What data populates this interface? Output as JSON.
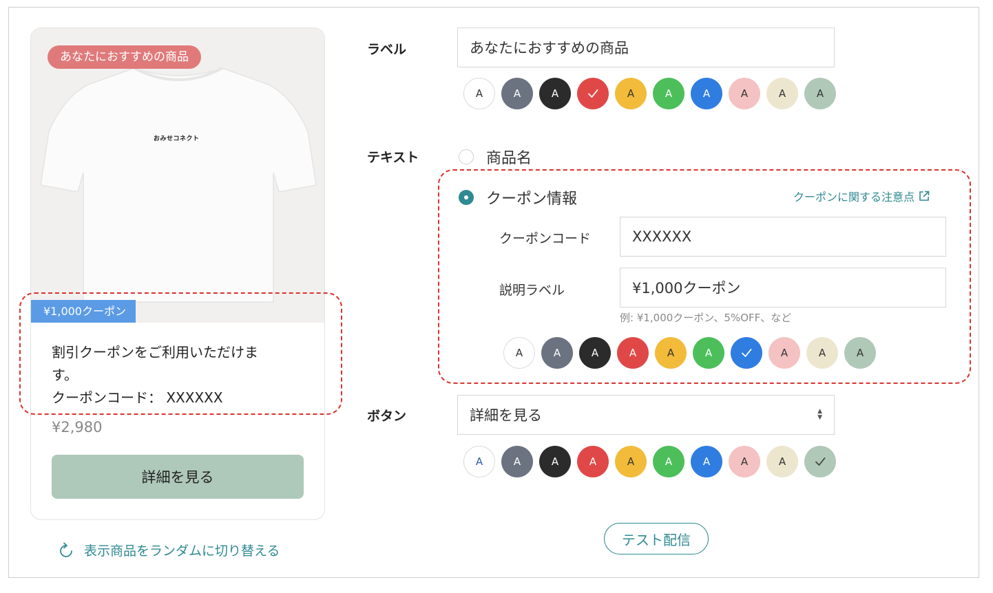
{
  "preview": {
    "recommend_badge": "あなたにおすすめの商品",
    "shirt_logo_text": "おみせコネクト",
    "coupon_tag": "¥1,000クーポン",
    "desc_line1": "割引クーポンをご利用いただけま",
    "desc_line2": "す。",
    "code_line": "クーポンコード： XXXXXX",
    "price": "¥2,980",
    "detail_button": "詳細を見る",
    "shuffle_link": "表示商品をランダムに切り替える"
  },
  "form": {
    "label_section": {
      "title": "ラベル",
      "value": "あなたにおすすめの商品"
    },
    "text_section": {
      "title": "テキスト",
      "option_product": "商品名",
      "option_coupon": "クーポン情報",
      "notes_link": "クーポンに関する注意点",
      "coupon_code_label": "クーポンコード",
      "coupon_code_value": "XXXXXX",
      "desc_label": "説明ラベル",
      "desc_value": "¥1,000クーポン",
      "desc_hint": "例: ¥1,000クーポン、5%OFF、など"
    },
    "button_section": {
      "title": "ボタン",
      "selected": "詳細を見る"
    },
    "test_send": "テスト配信"
  },
  "swatch_letter": "A",
  "palette": [
    {
      "name": "white",
      "bg": "#ffffff",
      "fg": "#333333"
    },
    {
      "name": "slate",
      "bg": "#6b7280",
      "fg": "#ffffff"
    },
    {
      "name": "black",
      "bg": "#2b2b2b",
      "fg": "#ffffff"
    },
    {
      "name": "red",
      "bg": "#e04848",
      "fg": "#ffffff"
    },
    {
      "name": "yellow",
      "bg": "#f2bb3a",
      "fg": "#333333"
    },
    {
      "name": "green",
      "bg": "#4cbf5b",
      "fg": "#ffffff"
    },
    {
      "name": "blue",
      "bg": "#2f7de1",
      "fg": "#ffffff"
    },
    {
      "name": "pink",
      "bg": "#f4c2c2",
      "fg": "#333333"
    },
    {
      "name": "cream",
      "bg": "#ede6cf",
      "fg": "#333333"
    },
    {
      "name": "sage",
      "bg": "#b0c8b8",
      "fg": "#333333"
    }
  ],
  "swatch_rows": {
    "label": {
      "selected": 3,
      "white_fg": "#333333"
    },
    "text": {
      "selected": 6,
      "white_fg": "#333333"
    },
    "button": {
      "selected": 9,
      "white_fg": "#2f5da8"
    }
  }
}
